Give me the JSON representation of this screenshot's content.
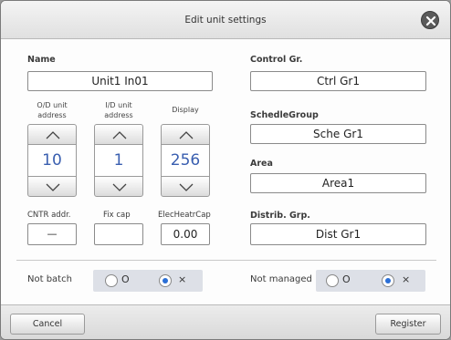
{
  "dialog": {
    "title": "Edit unit settings"
  },
  "name": {
    "label": "Name",
    "value": "Unit1 In01"
  },
  "address": {
    "od_header": "O/D unit address",
    "id_header": "I/D unit address",
    "display_header": "Display",
    "od_value": "10",
    "id_value": "1",
    "display_value": "256"
  },
  "control_group": {
    "label": "Control Gr.",
    "value": "Ctrl Gr1"
  },
  "schedule_group": {
    "label": "SchedleGroup",
    "value": "Sche Gr1"
  },
  "area": {
    "label": "Area",
    "value": "Area1"
  },
  "cntr": {
    "label": "CNTR addr.",
    "value": "—"
  },
  "fix_cap": {
    "label": "Fix cap",
    "value": ""
  },
  "elec_heatr_cap": {
    "label": "ElecHeatrCap",
    "value": "0.00"
  },
  "distrib_group": {
    "label": "Distrib. Grp.",
    "value": "Dist Gr1"
  },
  "not_batch": {
    "label": "Not batch",
    "option_o": "O",
    "option_x": "×",
    "selected": "×"
  },
  "not_managed": {
    "label": "Not managed",
    "option_o": "O",
    "option_x": "×",
    "selected": "×"
  },
  "buttons": {
    "cancel": "Cancel",
    "register": "Register"
  },
  "colors": {
    "accent": "#3a5fb0",
    "radio_selected": "#2b6fd6",
    "group_bg": "#dde0e7"
  },
  "icons": {
    "close": "close-icon",
    "up": "chevron-up-icon",
    "down": "chevron-down-icon"
  }
}
